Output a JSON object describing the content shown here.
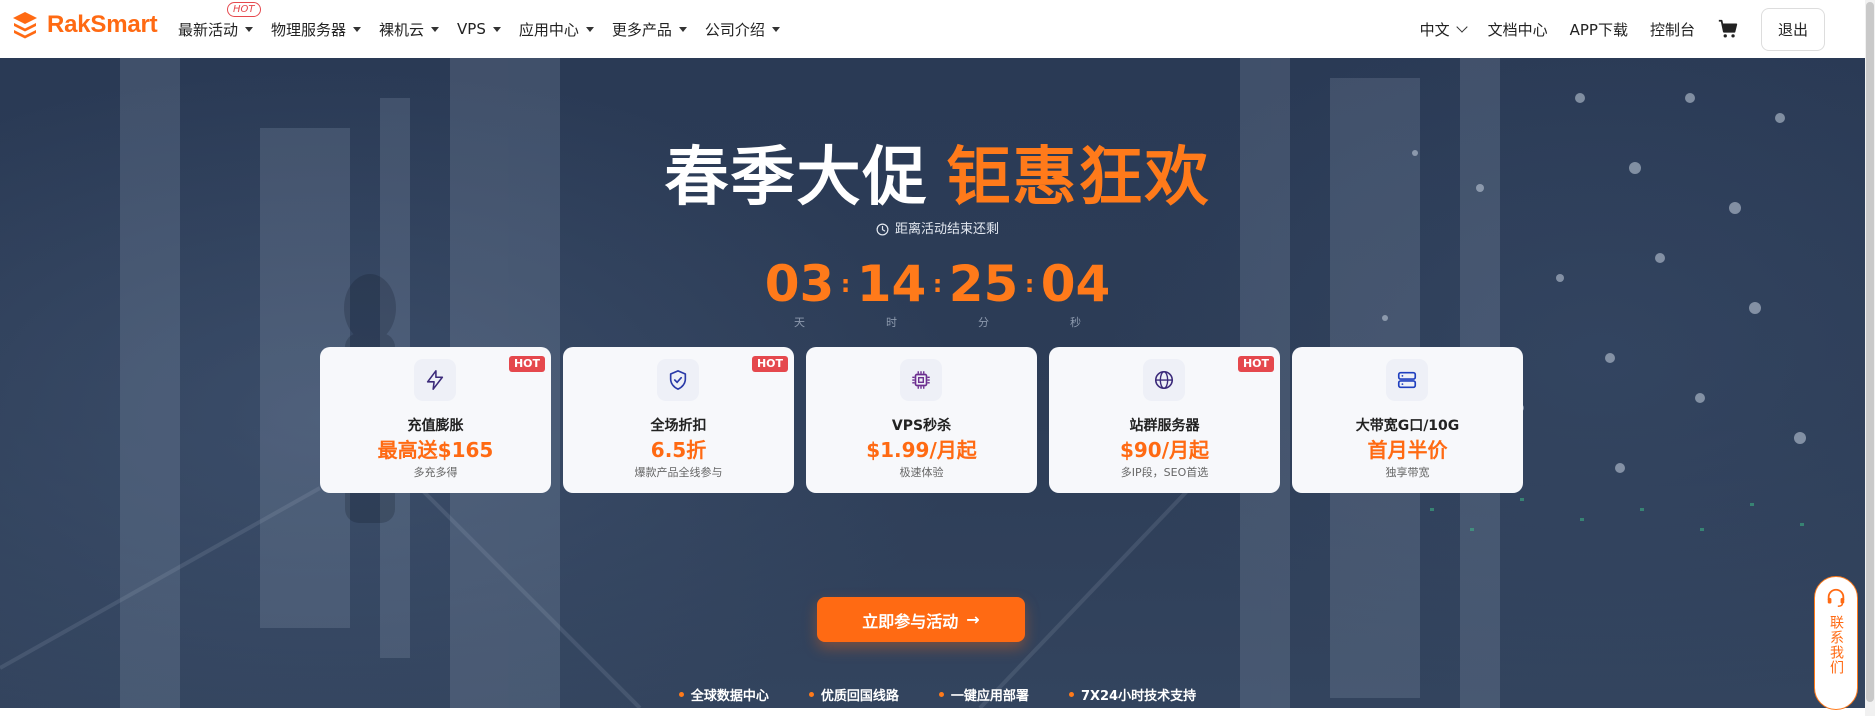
{
  "header": {
    "brand": "RakSmart",
    "nav": [
      {
        "label": "最新活动",
        "badge": "HOT"
      },
      {
        "label": "物理服务器"
      },
      {
        "label": "裸机云"
      },
      {
        "label": "VPS"
      },
      {
        "label": "应用中心"
      },
      {
        "label": "更多产品"
      },
      {
        "label": "公司介绍"
      }
    ],
    "language": "中文",
    "docs": "文档中心",
    "app_download": "APP下载",
    "console": "控制台",
    "logout": "退出"
  },
  "hero": {
    "headline_white": "春季大促",
    "headline_orange": "钜惠狂欢",
    "countdown_label": "距离活动结束还剩",
    "countdown": [
      {
        "value": "03",
        "unit": "天"
      },
      {
        "value": "14",
        "unit": "时"
      },
      {
        "value": "25",
        "unit": "分"
      },
      {
        "value": "04",
        "unit": "秒"
      }
    ],
    "cards": [
      {
        "icon": "lightning-icon",
        "title": "充值膨胀",
        "value": "最高送$165",
        "sub": "多充多得",
        "hot": "HOT"
      },
      {
        "icon": "shield-check-icon",
        "title": "全场折扣",
        "value": "6.5折",
        "sub": "爆款产品全线参与",
        "hot": "HOT"
      },
      {
        "icon": "cpu-chip-icon",
        "title": "VPS秒杀",
        "value": "$1.99/月起",
        "sub": "极速体验",
        "hot": ""
      },
      {
        "icon": "globe-icon",
        "title": "站群服务器",
        "value": "$90/月起",
        "sub": "多IP段，SEO首选",
        "hot": "HOT"
      },
      {
        "icon": "server-icon",
        "title": "大带宽G口/10G",
        "value": "首月半价",
        "sub": "独享带宽",
        "hot": ""
      }
    ],
    "cta_label": "立即参与活动",
    "features": [
      "全球数据中心",
      "优质回国线路",
      "一键应用部署",
      "7X24小时技术支持"
    ]
  },
  "contact": {
    "label": "联系我们"
  },
  "colors": {
    "accent": "#ff6a13",
    "hero_bg": "#2d3d57",
    "hot_red": "#e5484d"
  }
}
